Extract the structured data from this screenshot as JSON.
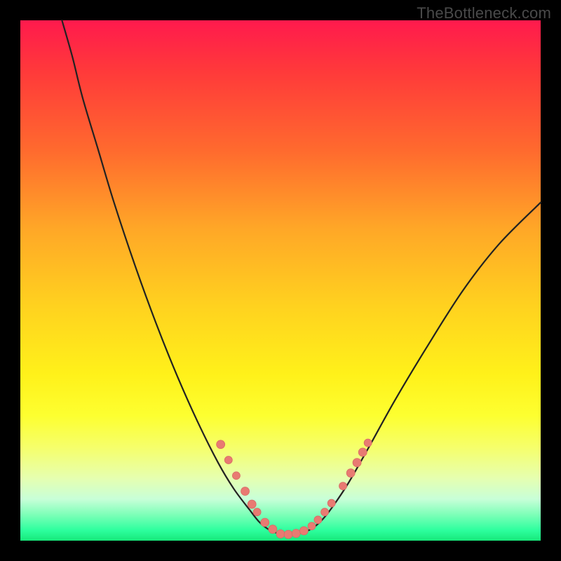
{
  "watermark": "TheBottleneck.com",
  "colors": {
    "frame": "#000000",
    "curve_stroke": "#222222",
    "marker_fill": "#e87a72",
    "marker_stroke": "#d86a64"
  },
  "chart_data": {
    "type": "line",
    "title": "",
    "xlabel": "",
    "ylabel": "",
    "xlim": [
      0,
      100
    ],
    "ylim": [
      0,
      100
    ],
    "grid": false,
    "legend": false,
    "series": [
      {
        "name": "bottleneck-curve",
        "x": [
          8,
          10,
          12,
          15,
          18,
          22,
          26,
          30,
          34,
          38,
          41,
          44,
          46,
          48,
          50,
          52,
          54,
          56,
          58,
          60,
          63,
          67,
          72,
          78,
          85,
          92,
          100
        ],
        "y": [
          100,
          93,
          85,
          75,
          65,
          53,
          42,
          32,
          23,
          15,
          10,
          6,
          3.5,
          2,
          1.3,
          1.2,
          1.5,
          2.3,
          4,
          6.5,
          11,
          18,
          27,
          37,
          48,
          57,
          65
        ]
      }
    ],
    "markers": [
      {
        "x": 38.5,
        "y": 18.5,
        "r": 6
      },
      {
        "x": 40.0,
        "y": 15.5,
        "r": 5.5
      },
      {
        "x": 41.5,
        "y": 12.5,
        "r": 5.5
      },
      {
        "x": 43.2,
        "y": 9.5,
        "r": 6
      },
      {
        "x": 44.5,
        "y": 7.0,
        "r": 6
      },
      {
        "x": 45.5,
        "y": 5.5,
        "r": 5.5
      },
      {
        "x": 47.0,
        "y": 3.5,
        "r": 6
      },
      {
        "x": 48.5,
        "y": 2.2,
        "r": 6
      },
      {
        "x": 50.0,
        "y": 1.3,
        "r": 6
      },
      {
        "x": 51.5,
        "y": 1.2,
        "r": 6
      },
      {
        "x": 53.0,
        "y": 1.4,
        "r": 6
      },
      {
        "x": 54.5,
        "y": 1.9,
        "r": 6
      },
      {
        "x": 56.0,
        "y": 2.8,
        "r": 5.5
      },
      {
        "x": 57.2,
        "y": 4.0,
        "r": 5.5
      },
      {
        "x": 58.5,
        "y": 5.5,
        "r": 5.5
      },
      {
        "x": 59.8,
        "y": 7.2,
        "r": 5.5
      },
      {
        "x": 62.0,
        "y": 10.5,
        "r": 5.5
      },
      {
        "x": 63.5,
        "y": 13.0,
        "r": 6
      },
      {
        "x": 64.7,
        "y": 15.0,
        "r": 6
      },
      {
        "x": 65.8,
        "y": 17.0,
        "r": 6
      },
      {
        "x": 66.8,
        "y": 18.8,
        "r": 5.5
      }
    ]
  }
}
